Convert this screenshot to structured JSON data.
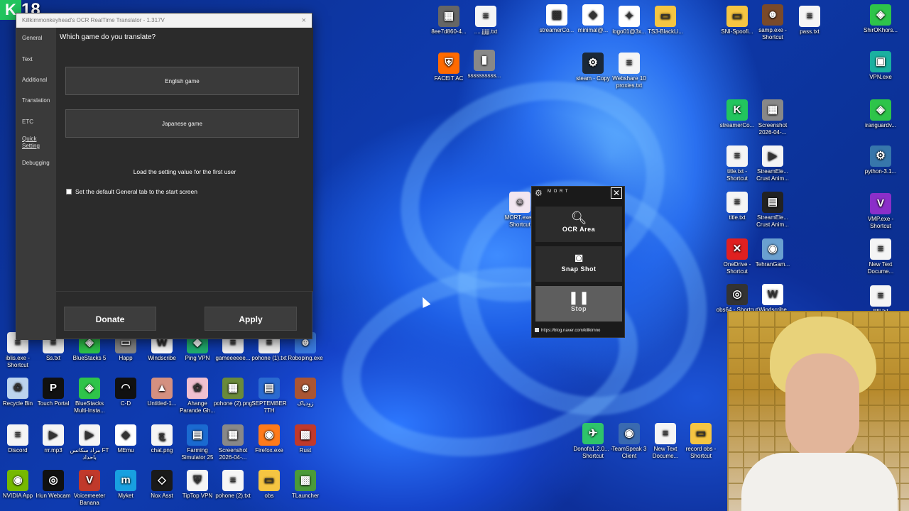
{
  "badge": {
    "letter": "K",
    "number": "18"
  },
  "app": {
    "title": "Killkimmonkeyhead's OCR RealTime Translator - 1.317V",
    "close": "×",
    "sidebar": [
      "General",
      "Text",
      "Additional",
      "Translation",
      "ETC",
      "Quick Setting",
      "Debugging"
    ],
    "question": "Which game do you translate?",
    "english_game": "English game",
    "japanese_game": "Japanese game",
    "load_setting": "Load the setting value for the first user",
    "default_tab": "Set the default General tab to the start screen",
    "donate": "Donate",
    "apply": "Apply"
  },
  "mort": {
    "logo": "M O R T",
    "close": "✕",
    "ocr_area": "OCR Area",
    "snap_shot": "Snap Shot",
    "stop": "Stop",
    "url": "https://blog.naver.com/killkimno"
  },
  "desktop_icons": [
    {
      "label": "8ee7d860-4...",
      "color": "#666666",
      "glyph": "▦"
    },
    {
      "label": ".....jjjjjj.txt",
      "color": "#f5f5f5",
      "glyph": "≡"
    },
    {
      "label": "streamerCo...",
      "color": "#ffffff",
      "glyph": "▩"
    },
    {
      "label": "minimal@...",
      "color": "#ffffff",
      "glyph": "◆"
    },
    {
      "label": "logo01@3x...",
      "color": "#ffffff",
      "glyph": "✦"
    },
    {
      "label": "TS3-BlackLi...",
      "color": "#f5c542",
      "glyph": "▭"
    },
    {
      "label": "SNI-Spoofi...",
      "color": "#f5c542",
      "glyph": "▭"
    },
    {
      "label": "samp.exe - Shortcut",
      "color": "#7a4a2a",
      "glyph": "☻"
    },
    {
      "label": "pass.txt",
      "color": "#f5f5f5",
      "glyph": "≡"
    },
    {
      "label": "ShirOKhors...",
      "color": "#2ec44a",
      "glyph": "◈"
    },
    {
      "label": "FACEIT AC",
      "color": "#ff6a00",
      "glyph": "⛨"
    },
    {
      "label": "ssssssssss...",
      "color": "#888888",
      "glyph": "▮"
    },
    {
      "label": "steam - Copy",
      "color": "#1b2838",
      "glyph": "⚙"
    },
    {
      "label": "Webshare 10 proxies.txt",
      "color": "#f5f5f5",
      "glyph": "≡"
    },
    {
      "label": "VPN.exe",
      "color": "#1ab0a0",
      "glyph": "▣"
    },
    {
      "label": "streamerCo...",
      "color": "#22c55e",
      "glyph": "K"
    },
    {
      "label": "Screenshot 2026-04-...",
      "color": "#888888",
      "glyph": "▦"
    },
    {
      "label": "iranguardv...",
      "color": "#2ec44a",
      "glyph": "◈"
    },
    {
      "label": "title.txt - Shortcut",
      "color": "#f5f5f5",
      "glyph": "≡"
    },
    {
      "label": "StreamEle... Crust Anim...",
      "color": "#f5f5f5",
      "glyph": "▶"
    },
    {
      "label": "python-3.1...",
      "color": "#3776ab",
      "glyph": "⚙"
    },
    {
      "label": "MORT.exe - Shortcut",
      "color": "#f2e6f0",
      "glyph": "☺"
    },
    {
      "label": "title.txt",
      "color": "#f5f5f5",
      "glyph": "≡"
    },
    {
      "label": "StreamEle... Crust Anim...",
      "color": "#222222",
      "glyph": "▤"
    },
    {
      "label": "VMP.exe - Shortcut",
      "color": "#8b2fc9",
      "glyph": "V"
    },
    {
      "label": "OneDrive - Shortcut",
      "color": "#e02020",
      "glyph": "✕"
    },
    {
      "label": "TehranGam...",
      "color": "#6aa0d0",
      "glyph": "◉"
    },
    {
      "label": "New Text Docume...",
      "color": "#f5f5f5",
      "glyph": "≡"
    },
    {
      "label": "obs64 - Shortcut",
      "color": "#333333",
      "glyph": "◎"
    },
    {
      "label": "Windscribe",
      "color": "#ffffff",
      "glyph": "W"
    },
    {
      "label": "llllll.txt",
      "color": "#f5f5f5",
      "glyph": "≡"
    },
    {
      "label": "iblis.exe - Shortcut",
      "color": "#f5f5f5",
      "glyph": "≡"
    },
    {
      "label": "Ss.txt",
      "color": "#f5f5f5",
      "glyph": "≡"
    },
    {
      "label": "BlueStacks 5",
      "color": "#2ec44a",
      "glyph": "◈"
    },
    {
      "label": "Happ",
      "color": "#888888",
      "glyph": "▭"
    },
    {
      "label": "Windscribe",
      "color": "#ffffff",
      "glyph": "W"
    },
    {
      "label": "Ping VPN",
      "color": "#20b070",
      "glyph": "◆"
    },
    {
      "label": "gameeeeee...",
      "color": "#f5f5f5",
      "glyph": "≡"
    },
    {
      "label": "pohone (1).txt",
      "color": "#f5f5f5",
      "glyph": "≡"
    },
    {
      "label": "Roboping.exe",
      "color": "#3a7be0",
      "glyph": "☻"
    },
    {
      "label": "Recycle Bin",
      "color": "#bcd4ee",
      "glyph": "♻"
    },
    {
      "label": "Touch Portal",
      "color": "#111111",
      "glyph": "P"
    },
    {
      "label": "BlueStacks Multi-Insta...",
      "color": "#2ec44a",
      "glyph": "◈"
    },
    {
      "label": "C-D",
      "color": "#111111",
      "glyph": "◠"
    },
    {
      "label": "Untitled-1...",
      "color": "#d49080",
      "glyph": "▲"
    },
    {
      "label": "Ahange Parande Gh...",
      "color": "#f0c0d0",
      "glyph": "✿"
    },
    {
      "label": "pohone (2).png",
      "color": "#6a8a3a",
      "glyph": "▦"
    },
    {
      "label": "SEPTEMBER 7TH",
      "color": "#2a6ad0",
      "glyph": "▤"
    },
    {
      "label": "زودیاک",
      "color": "#aa5533",
      "glyph": "☻"
    },
    {
      "label": "Discord",
      "color": "#f5f5f5",
      "glyph": "≡"
    },
    {
      "label": "rrr.mp3",
      "color": "#f5f5f5",
      "glyph": "▶"
    },
    {
      "label": "مراد سکانس FT باحداد",
      "color": "#f5f5f5",
      "glyph": "▶"
    },
    {
      "label": "MEmu",
      "color": "#ffffff",
      "glyph": "◆"
    },
    {
      "label": "chat.png",
      "color": "#f5f5f5",
      "glyph": "چ"
    },
    {
      "label": "Farming Simulator 25",
      "color": "#1a6ad0",
      "glyph": "▤"
    },
    {
      "label": "Screenshot 2026-04-...",
      "color": "#888888",
      "glyph": "▦"
    },
    {
      "label": "Firefox.exe",
      "color": "#ff7a1a",
      "glyph": "◉"
    },
    {
      "label": "Rust",
      "color": "#c0392b",
      "glyph": "▩"
    },
    {
      "label": "NVIDIA App",
      "color": "#76b900",
      "glyph": "◉"
    },
    {
      "label": "Iriun Webcam",
      "color": "#111111",
      "glyph": "◎"
    },
    {
      "label": "Voicemeeter Banana",
      "color": "#c0392b",
      "glyph": "V"
    },
    {
      "label": "Myket",
      "color": "#18a0e0",
      "glyph": "m"
    },
    {
      "label": "Nox Asst",
      "color": "#1a1a1a",
      "glyph": "◇"
    },
    {
      "label": "TipTop VPN",
      "color": "#f5f5f5",
      "glyph": "⛨"
    },
    {
      "label": "pohone (2).txt",
      "color": "#f5f5f5",
      "glyph": "≡"
    },
    {
      "label": "obs",
      "color": "#f5c542",
      "glyph": "▭"
    },
    {
      "label": "TLauncher",
      "color": "#4a9a3a",
      "glyph": "▩"
    },
    {
      "label": "Donofa1.2.0... - Shortcut",
      "color": "#2ec46a",
      "glyph": "✈"
    },
    {
      "label": "TeamSpeak 3 Client",
      "color": "#3a6ab0",
      "glyph": "◉"
    },
    {
      "label": "New Text Docume...",
      "color": "#f5f5f5",
      "glyph": "≡"
    },
    {
      "label": "record obs - Shortcut",
      "color": "#f5c542",
      "glyph": "▭"
    }
  ]
}
